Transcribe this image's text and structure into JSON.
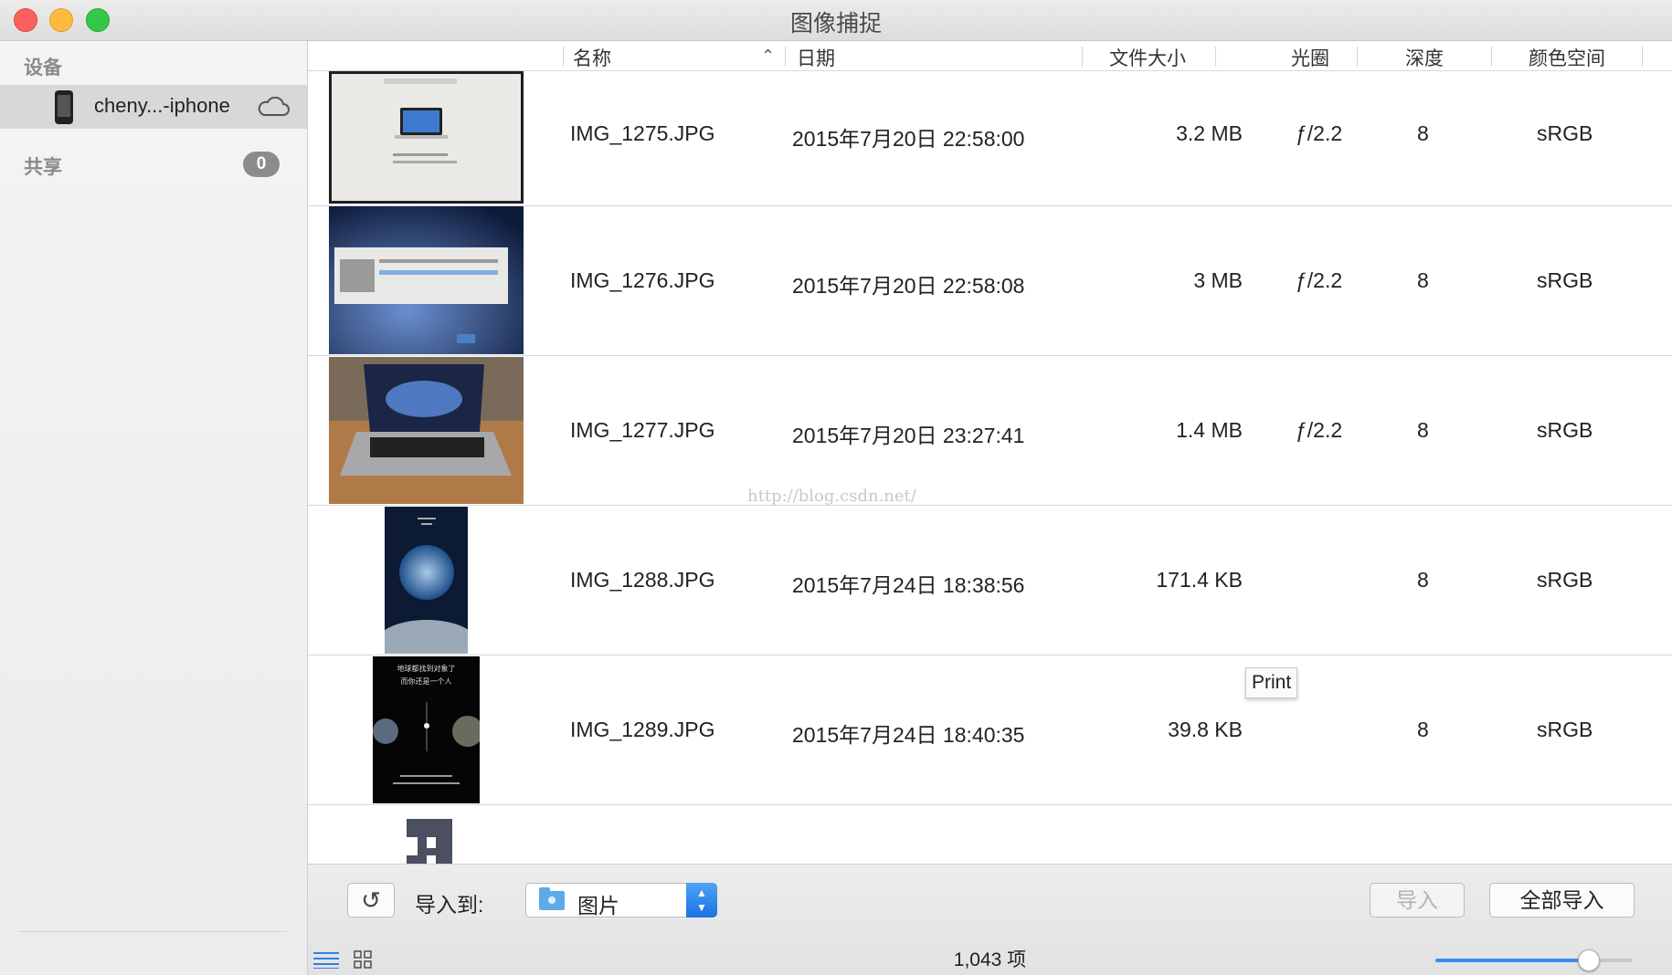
{
  "window": {
    "title": "图像捕捉"
  },
  "sidebar": {
    "devices_heading": "设备",
    "device_name": "cheny...-iphone",
    "shared_heading": "共享",
    "shared_count": "0"
  },
  "table": {
    "columns": [
      "名称",
      "日期",
      "文件大小",
      "光圈",
      "深度",
      "颜色空间"
    ],
    "rows": [
      {
        "name": "IMG_1275.JPG",
        "date": "2015年7月20日 22:58:00",
        "size": "3.2 MB",
        "aperture": "ƒ/2.2",
        "depth": "8",
        "color_space": "sRGB"
      },
      {
        "name": "IMG_1276.JPG",
        "date": "2015年7月20日 22:58:08",
        "size": "3 MB",
        "aperture": "ƒ/2.2",
        "depth": "8",
        "color_space": "sRGB"
      },
      {
        "name": "IMG_1277.JPG",
        "date": "2015年7月20日 23:27:41",
        "size": "1.4 MB",
        "aperture": "ƒ/2.2",
        "depth": "8",
        "color_space": "sRGB"
      },
      {
        "name": "IMG_1288.JPG",
        "date": "2015年7月24日 18:38:56",
        "size": "171.4 KB",
        "aperture": "",
        "depth": "8",
        "color_space": "sRGB"
      },
      {
        "name": "IMG_1289.JPG",
        "date": "2015年7月24日 18:40:35",
        "size": "39.8 KB",
        "aperture": "",
        "depth": "8",
        "color_space": "sRGB"
      }
    ]
  },
  "thumbnails": {
    "row4_lines": [
      "地球都找到对象了",
      "而你还是一个人"
    ]
  },
  "tooltip": "Print",
  "watermark": "http://blog.csdn.net/",
  "bottom": {
    "import_to_label": "导入到:",
    "destination": "图片",
    "import_button": "导入",
    "import_all_button": "全部导入",
    "item_count": "1,043 项",
    "zoom_level": 0.78
  },
  "colors": {
    "accent": "#3b8ef0",
    "close": "#fc605c",
    "minimize": "#fdbc40",
    "zoom": "#34c84a"
  }
}
